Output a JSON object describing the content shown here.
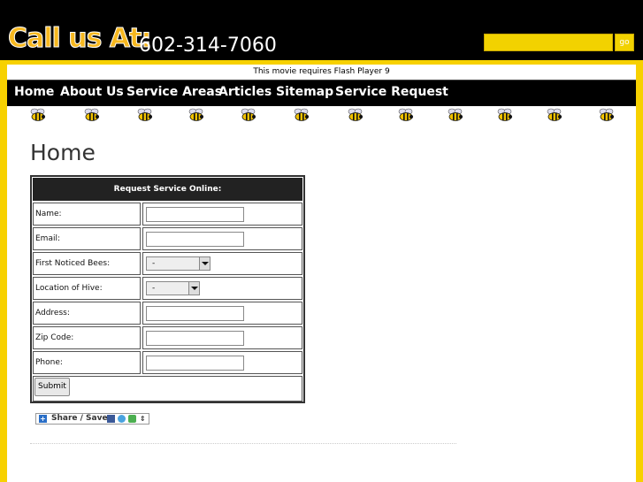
{
  "header": {
    "call_label": "Call us At:",
    "phone": "602-314-7060",
    "search": {
      "placeholder": "",
      "button_label": "go"
    }
  },
  "flash_notice": "This movie requires Flash Player 9",
  "nav": {
    "items": [
      {
        "label": "Home"
      },
      {
        "label": "About Us"
      },
      {
        "label": "Service Areas"
      },
      {
        "label": "Articles"
      },
      {
        "label": "Sitemap"
      },
      {
        "label": "Service Request"
      }
    ]
  },
  "page": {
    "title": "Home"
  },
  "form": {
    "heading": "Request Service Online:",
    "fields": [
      {
        "label": "Name:",
        "type": "text",
        "value": ""
      },
      {
        "label": "Email:",
        "type": "text",
        "value": ""
      },
      {
        "label": "First Noticed Bees:",
        "type": "select",
        "value": "-"
      },
      {
        "label": "Location of Hive:",
        "type": "select",
        "value": "-"
      },
      {
        "label": "Address:",
        "type": "text",
        "value": ""
      },
      {
        "label": "Zip Code:",
        "type": "text",
        "value": ""
      },
      {
        "label": "Phone:",
        "type": "text",
        "value": ""
      }
    ],
    "submit_label": "Submit"
  },
  "share": {
    "label": "Share / Save"
  },
  "colors": {
    "accent_yellow": "#f7d100",
    "nav_bg": "#000000",
    "call_orange": "#f7b81f"
  },
  "icons": [
    "bee-icon",
    "share-plus-icon",
    "facebook-icon",
    "twitter-icon",
    "share-icon",
    "chevron-down-icon"
  ]
}
